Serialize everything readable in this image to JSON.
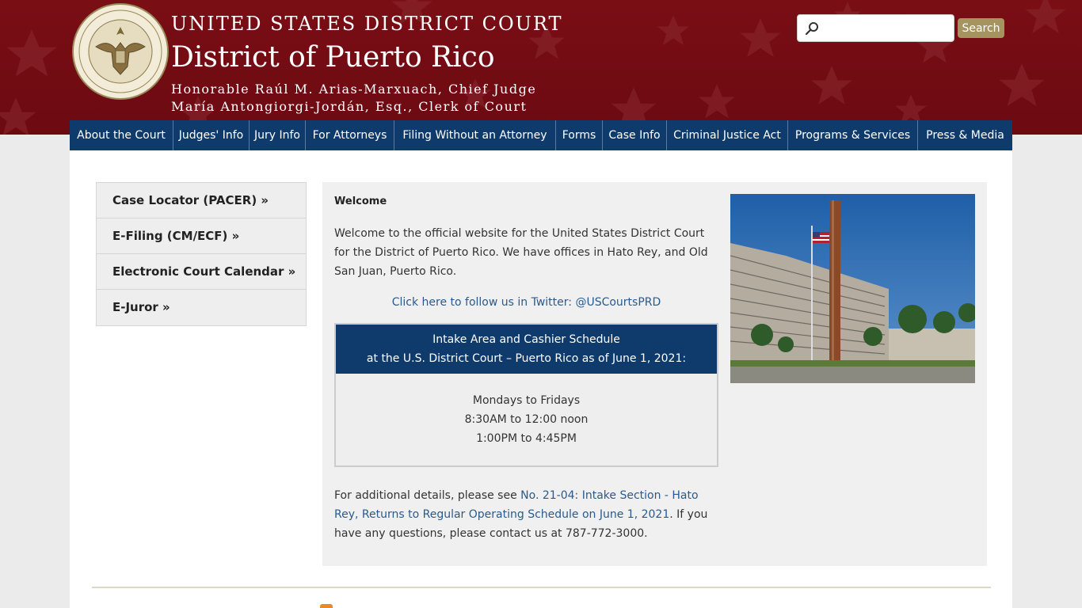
{
  "header": {
    "court_name": "UNITED STATES DISTRICT COURT",
    "district": "District of Puerto Rico",
    "chief_judge": "Honorable Raúl M. Arias-Marxuach, Chief Judge",
    "clerk": "María Antongiorgi-Jordán, Esq., Clerk of Court",
    "seal_text": "UNITED STATES DISTRICT COURT · FOR THE DISTRICT OF PUERTO RICO"
  },
  "search": {
    "placeholder": "",
    "button_label": "Search"
  },
  "nav": {
    "items": [
      {
        "label": "About the Court"
      },
      {
        "label": "Judges' Info"
      },
      {
        "label": "Jury Info"
      },
      {
        "label": "For Attorneys"
      },
      {
        "label": "Filing Without an Attorney"
      },
      {
        "label": "Forms"
      },
      {
        "label": "Case Info"
      },
      {
        "label": "Criminal Justice Act"
      },
      {
        "label": "Programs & Services"
      },
      {
        "label": "Press & Media"
      }
    ]
  },
  "sidebar": {
    "items": [
      {
        "label": "Case Locator (PACER) »"
      },
      {
        "label": "E-Filing (CM/ECF) »"
      },
      {
        "label": "Electronic Court Calendar »"
      },
      {
        "label": "E-Juror »"
      }
    ]
  },
  "main": {
    "title": "Welcome",
    "intro": "Welcome to the official website for the United States District Court for the District of Puerto Rico. We have offices in Hato Rey, and Old San Juan, Puerto Rico.",
    "twitter_link": "Click here to follow us in Twitter: @USCourtsPRD",
    "schedule": {
      "heading_1": "Intake Area and Cashier Schedule",
      "heading_2": "at the U.S. District Court – Puerto Rico as of June 1, 2021:",
      "days": "Mondays to Fridays",
      "morning": "8:30AM to 12:00 noon",
      "afternoon": "1:00PM to 4:45PM"
    },
    "details_prefix": "For additional details, please see ",
    "details_link": "No. 21-04: Intake Section - Hato Rey, Returns to Regular Operating Schedule on June 1, 2021",
    "details_suffix": ". If you have any questions, please contact us at 787-772-3000."
  },
  "colors": {
    "header_bg": "#6c0a12",
    "nav_bg": "#0e3a6c",
    "search_button": "#a59360",
    "link": "#2a5a8c"
  },
  "icons": {
    "search": "magnifier-icon",
    "rss": "rss-icon"
  }
}
